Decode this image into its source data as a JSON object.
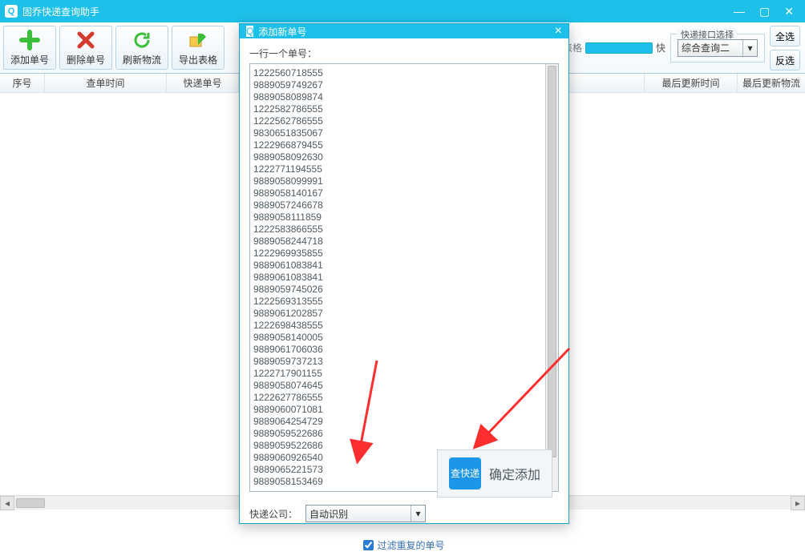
{
  "app": {
    "title": "固乔快递查询助手"
  },
  "toolbar": {
    "add_label": "添加单号",
    "del_label": "删除单号",
    "refresh_label": "刷新物流",
    "export_label": "导出表格",
    "scroll_check": "查询时滚动表格",
    "speed_label": "快",
    "iface_legend": "快递接口选择",
    "iface_value": "综合查询二",
    "select_all": "全选",
    "invert_sel": "反选"
  },
  "columns": {
    "seq": "序号",
    "time": "查单时间",
    "num": "快递单号",
    "last_update": "最后更新时间",
    "last_logi": "最后更新物流"
  },
  "dialog": {
    "title": "添加新单号",
    "line_hint": "一行一个单号：",
    "company_label": "快递公司：",
    "company_value": "自动识别",
    "confirm_label": "确定添加",
    "confirm_logo": "查快递",
    "filter_dup": "过滤重复的单号",
    "numbers": [
      "1222560718555",
      "9889059749267",
      "9889058089874",
      "1222582786555",
      "1222562786555",
      "9830651835067",
      "1222966879455",
      "9889058092630",
      "1222771194555",
      "9889058099991",
      "9889058140167",
      "9889057246678",
      "9889058111859",
      "1222583866555",
      "9889058244718",
      "1222969935855",
      "9889061083841",
      "9889061083841",
      "9889059745026",
      "1222569313555",
      "9889061202857",
      "1222698438555",
      "9889058140005",
      "9889061706036",
      "9889059737213",
      "1222717901155",
      "9889058074645",
      "1222627786555",
      "9889060071081",
      "9889064254729",
      "9889059522686",
      "9889059522686",
      "9889060926540",
      "9889065221573",
      "9889058153469"
    ]
  }
}
